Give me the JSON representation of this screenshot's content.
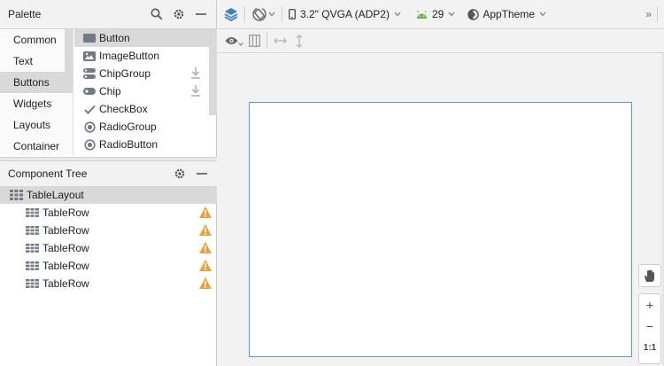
{
  "palette": {
    "title": "Palette",
    "categories": [
      "Common",
      "Text",
      "Buttons",
      "Widgets",
      "Layouts",
      "Container"
    ],
    "selected_category": "Buttons",
    "items": [
      {
        "label": "Button",
        "icon": "button-icon"
      },
      {
        "label": "ImageButton",
        "icon": "image-button-icon"
      },
      {
        "label": "ChipGroup",
        "icon": "chip-group-icon",
        "download": true
      },
      {
        "label": "Chip",
        "icon": "chip-icon",
        "download": true
      },
      {
        "label": "CheckBox",
        "icon": "checkbox-icon"
      },
      {
        "label": "RadioGroup",
        "icon": "radio-group-icon"
      },
      {
        "label": "RadioButton",
        "icon": "radio-button-icon"
      }
    ]
  },
  "component_tree": {
    "title": "Component Tree",
    "root": "TableLayout",
    "children": [
      "TableRow",
      "TableRow",
      "TableRow",
      "TableRow",
      "TableRow"
    ]
  },
  "toolbar": {
    "device": "3.2\" QVGA (ADP2)",
    "api_level": "29",
    "theme": "AppTheme",
    "overflow": "»"
  },
  "zoom": {
    "zoom_in": "+",
    "zoom_out": "−",
    "actual_size": "1:1"
  },
  "colors": {
    "accent_blue": "#3b83c5",
    "warning": "#e8a33d",
    "android_green": "#6ab344",
    "device_border": "#4ba3c7"
  }
}
